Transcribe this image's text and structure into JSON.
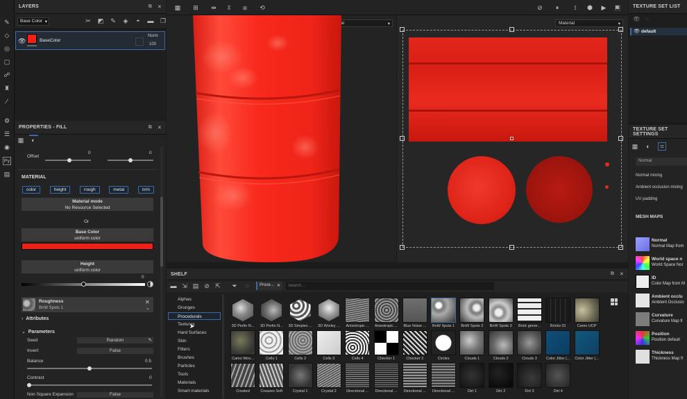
{
  "layers_panel": {
    "title": "LAYERS",
    "channel_select": "Base Color",
    "layer_name": "BaseColor",
    "blend_mode": "Norm",
    "opacity": "100"
  },
  "properties_panel": {
    "title": "PROPERTIES - FILL",
    "offset_label": "Offset",
    "offset_x": "0",
    "offset_y": "0",
    "material_title": "MATERIAL",
    "channel_chips": [
      "color",
      "height",
      "rough",
      "metal",
      "nrm"
    ],
    "material_mode_label": "Material mode",
    "material_mode_value": "No Resource Selected",
    "or_label": "Or",
    "base_color_label": "Base Color",
    "base_color_sub": "uniform color",
    "base_color_hex": "#f21f17",
    "height_label": "Height",
    "height_sub": "uniform color",
    "height_value": "0",
    "roughness_label": "Roughness",
    "roughness_sub": "BnW Spots 1",
    "attributes_label": "Attributes",
    "parameters_label": "Parameters",
    "seed_label": "Seed",
    "seed_value": "Random",
    "invert_label": "Invert",
    "invert_value": "False",
    "balance_label": "Balance",
    "balance_value": "0.5",
    "contrast_label": "Contrast",
    "contrast_value": "0",
    "nonsquare_label": "Non Square Expansion",
    "nonsquare_value": "False"
  },
  "viewport": {
    "left_mode": "Material",
    "right_mode": "Material"
  },
  "shelf": {
    "title": "SHELF",
    "filter_chip": "Proce...",
    "search_placeholder": "Search...",
    "categories": [
      "Alphas",
      "Grunges",
      "Procedurals",
      "Textures",
      "Hard Surfaces",
      "Skin",
      "Filters",
      "Brushes",
      "Particles",
      "Tools",
      "Materials",
      "Smart materials"
    ],
    "selected_category": "Procedurals",
    "row1": [
      "3D Perlin N...",
      "3D Perlin N...",
      "3D Simplex ...",
      "3D Worley ...",
      "Anisotropic ...",
      "Anisotropic ...",
      "Blue Noise ...",
      "BnW Spots 1",
      "BnW Spots 2",
      "BnW Spots 3",
      "Brick gener...",
      "Bricks 01",
      "Camo UCP"
    ],
    "row2": [
      "Camo Woo...",
      "Cells 1",
      "Cells 2",
      "Cells 3",
      "Cells 4",
      "Checker 1",
      "Checker 2",
      "Circles",
      "Clouds 1",
      "Clouds 2",
      "Clouds 3",
      "Color Jitter (...",
      "Color Jitter (..."
    ],
    "row3": [
      "Created",
      "Creases Soft",
      "Crystal 1",
      "Crystal 2",
      "Directional ...",
      "Directional ...",
      "Directional ...",
      "Directional ...",
      "Dirt 1",
      "Dirt 2",
      "Dirt 3",
      "Dirt 4"
    ]
  },
  "texture_set_list": {
    "title": "TEXTURE SET LIST",
    "item": "default"
  },
  "texture_set_settings": {
    "title": "TEXTURE SET SETTINGS",
    "normal_select": "Normal",
    "normal_mixing": "Normal mixing",
    "ao_mixing": "Ambient occlusion mixing",
    "uv_padding": "UV padding",
    "mesh_maps_title": "MESH MAPS",
    "mesh_maps": [
      {
        "name": "Normal",
        "sub": "Normal Map from"
      },
      {
        "name": "World space n",
        "sub": "World Space Nor"
      },
      {
        "name": "ID",
        "sub": "Color Map from M"
      },
      {
        "name": "Ambient occlu",
        "sub": "Ambient Occlusio"
      },
      {
        "name": "Curvature",
        "sub": "Curvature Map fr"
      },
      {
        "name": "Position",
        "sub": "Position default"
      },
      {
        "name": "Thickness",
        "sub": "Thickness Map fr"
      }
    ]
  },
  "colors": {
    "accent": "#3d6aa8",
    "paint_red": "#f21f17",
    "uv_red": "#e8281e"
  }
}
